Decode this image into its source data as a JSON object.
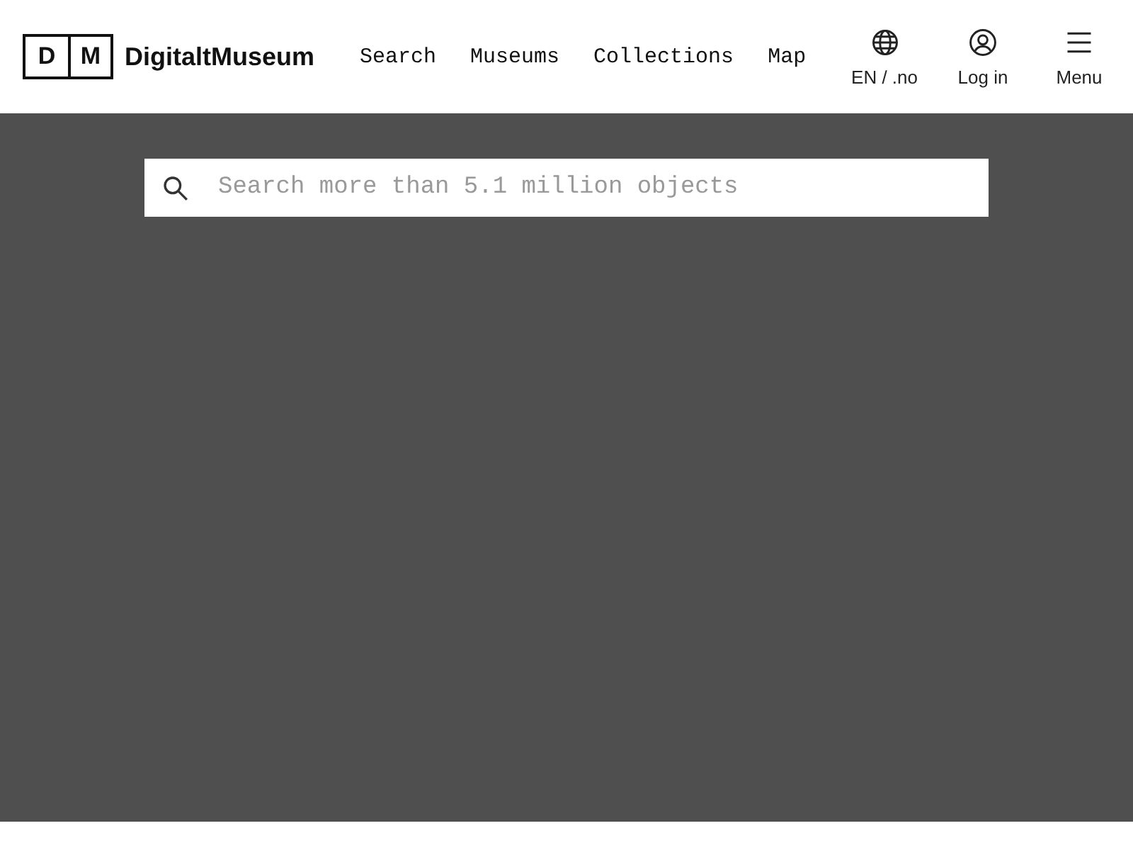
{
  "logo": {
    "letters": [
      "D",
      "M"
    ],
    "name": "DigitaltMuseum"
  },
  "nav": [
    "Search",
    "Museums",
    "Collections",
    "Map"
  ],
  "actions": [
    {
      "kind": "globe",
      "label": "EN / .no"
    },
    {
      "kind": "user",
      "label": "Log in"
    },
    {
      "kind": "menu",
      "label": "Menu"
    }
  ],
  "search": {
    "placeholder": "Search more than 5.1 million objects"
  }
}
